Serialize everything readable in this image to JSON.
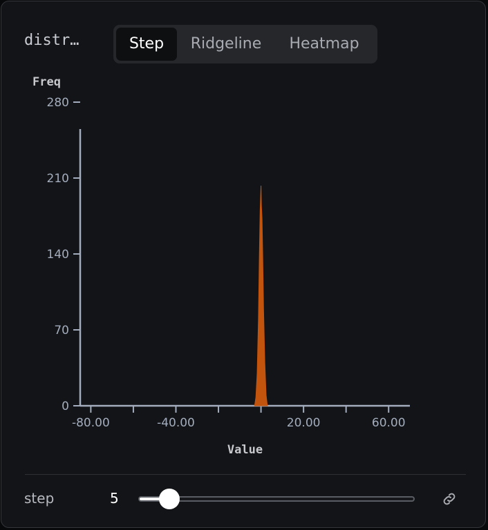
{
  "title": "distr…",
  "tabs": [
    {
      "label": "Step",
      "active": true
    },
    {
      "label": "Ridgeline",
      "active": false
    },
    {
      "label": "Heatmap",
      "active": false
    }
  ],
  "chart_data": {
    "type": "area",
    "title": "",
    "xlabel": "Value",
    "ylabel": "Freq",
    "xlim": [
      -85,
      70
    ],
    "ylim": [
      0,
      280
    ],
    "x_tick_labels": [
      -80,
      -40,
      20,
      60
    ],
    "x_tick_labels_text": [
      "-80.00",
      "-40.00",
      "20.00",
      "60.00"
    ],
    "x_minor_ticks": [
      -60,
      -20,
      0,
      40
    ],
    "y_ticks": [
      0,
      70,
      140,
      210,
      280
    ],
    "grid": false,
    "series": [
      {
        "color": "#c2540e",
        "x": [
          -3,
          -2.4,
          -1.8,
          -1.2,
          -0.8,
          -0.4,
          0,
          0.2,
          0.5,
          0.8,
          1.2,
          1.8,
          2.4,
          3
        ],
        "values": [
          0,
          8,
          30,
          80,
          135,
          180,
          203,
          185,
          172,
          140,
          90,
          40,
          10,
          0
        ]
      }
    ]
  },
  "controls": {
    "step_label": "step",
    "step_value": "5",
    "slider_fraction": 0.08
  },
  "icons": {
    "link": "link-icon"
  },
  "colors": {
    "accent": "#c2540e",
    "axis": "#a3adbd",
    "background": "#131417"
  }
}
